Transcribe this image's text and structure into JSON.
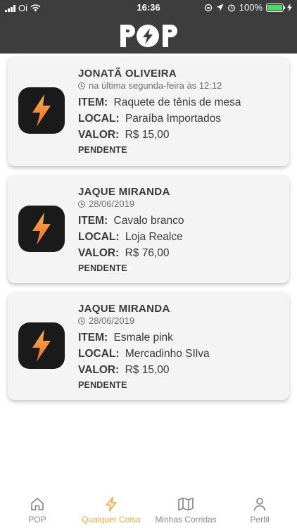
{
  "status_bar": {
    "carrier": "Oi",
    "time": "16:36",
    "battery": "100%",
    "battery_level": 1.0
  },
  "header": {
    "logo_text": "POP"
  },
  "requests": [
    {
      "name": "JONATÃ OLIVEIRA",
      "when": "na última segunda-feira às 12:12",
      "item_label": "ITEM:",
      "item": "Raquete de tênis de mesa",
      "local_label": "LOCAL:",
      "local": "Paraíba Importados",
      "valor_label": "VALOR:",
      "valor": "R$ 15,00",
      "status": "PENDENTE"
    },
    {
      "name": "JAQUE MIRANDA",
      "when": "28/06/2019",
      "item_label": "ITEM:",
      "item": "Cavalo branco",
      "local_label": "LOCAL:",
      "local": "Loja Realce",
      "valor_label": "VALOR:",
      "valor": "R$ 76,00",
      "status": "PENDENTE"
    },
    {
      "name": "JAQUE MIRANDA",
      "when": "28/06/2019",
      "item_label": "ITEM:",
      "item": "Esmale pink",
      "local_label": "LOCAL:",
      "local": "Mercadinho SIlva",
      "valor_label": "VALOR:",
      "valor": "R$ 15,00",
      "status": "PENDENTE"
    }
  ],
  "tabs": [
    {
      "label": "POP",
      "icon": "home-icon",
      "active": false
    },
    {
      "label": "Qualquer Coisa",
      "icon": "bolt-icon",
      "active": true
    },
    {
      "label": "Minhas Corridas",
      "icon": "map-icon",
      "active": false
    },
    {
      "label": "Perfil",
      "icon": "user-icon",
      "active": false
    }
  ],
  "colors": {
    "header_bg": "#3d3d3d",
    "accent": "#f3a93c",
    "card_bg": "#f4f4f4",
    "thumb_bg": "#1a1a1a",
    "battery": "#4cd964"
  }
}
